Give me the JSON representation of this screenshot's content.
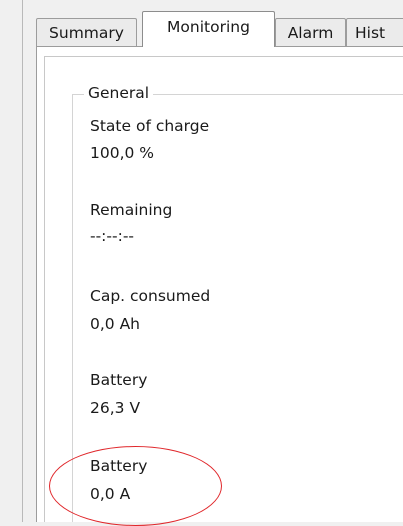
{
  "tabs": [
    {
      "label": "Summary",
      "active": false
    },
    {
      "label": "Monitoring",
      "active": true
    },
    {
      "label": "Alarm",
      "active": false
    },
    {
      "label": "Hist",
      "active": false
    }
  ],
  "group": {
    "title": "General",
    "fields": [
      {
        "label": "State of charge",
        "value": "100,0 %"
      },
      {
        "label": "Remaining",
        "value": "--:--:--"
      },
      {
        "label": "Cap. consumed",
        "value": "0,0 Ah"
      },
      {
        "label": "Battery",
        "value": "26,3 V"
      },
      {
        "label": "Battery",
        "value": "0,0 A"
      }
    ]
  },
  "colors": {
    "annotation": "#e0262a",
    "panel_bg": "#ffffff",
    "window_bg": "#f0f0f0"
  }
}
